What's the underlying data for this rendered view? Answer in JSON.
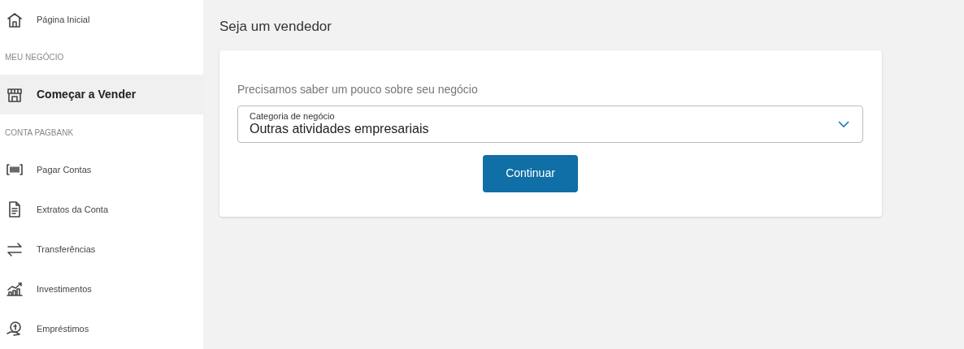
{
  "sidebar": {
    "items": [
      {
        "kind": "item",
        "label": "Página Inicial",
        "selected": false
      },
      {
        "kind": "header",
        "label": "MEU NEGÓCIO"
      },
      {
        "kind": "item",
        "label": "Começar a Vender",
        "selected": true
      },
      {
        "kind": "header",
        "label": "CONTA PAGBANK"
      },
      {
        "kind": "item",
        "label": "Pagar Contas",
        "selected": false
      },
      {
        "kind": "item",
        "label": "Extratos da Conta",
        "selected": false
      },
      {
        "kind": "item",
        "label": "Transferências",
        "selected": false
      },
      {
        "kind": "item",
        "label": "Investimentos",
        "selected": false
      },
      {
        "kind": "item",
        "label": "Empréstimos",
        "selected": false
      }
    ]
  },
  "page_title": "Seja um vendedor",
  "form": {
    "prompt": "Precisamos saber um pouco sobre seu negócio",
    "select": {
      "label": "Categoria de negócio",
      "value": "Outras atividades empresariais"
    },
    "button": "Continuar"
  }
}
